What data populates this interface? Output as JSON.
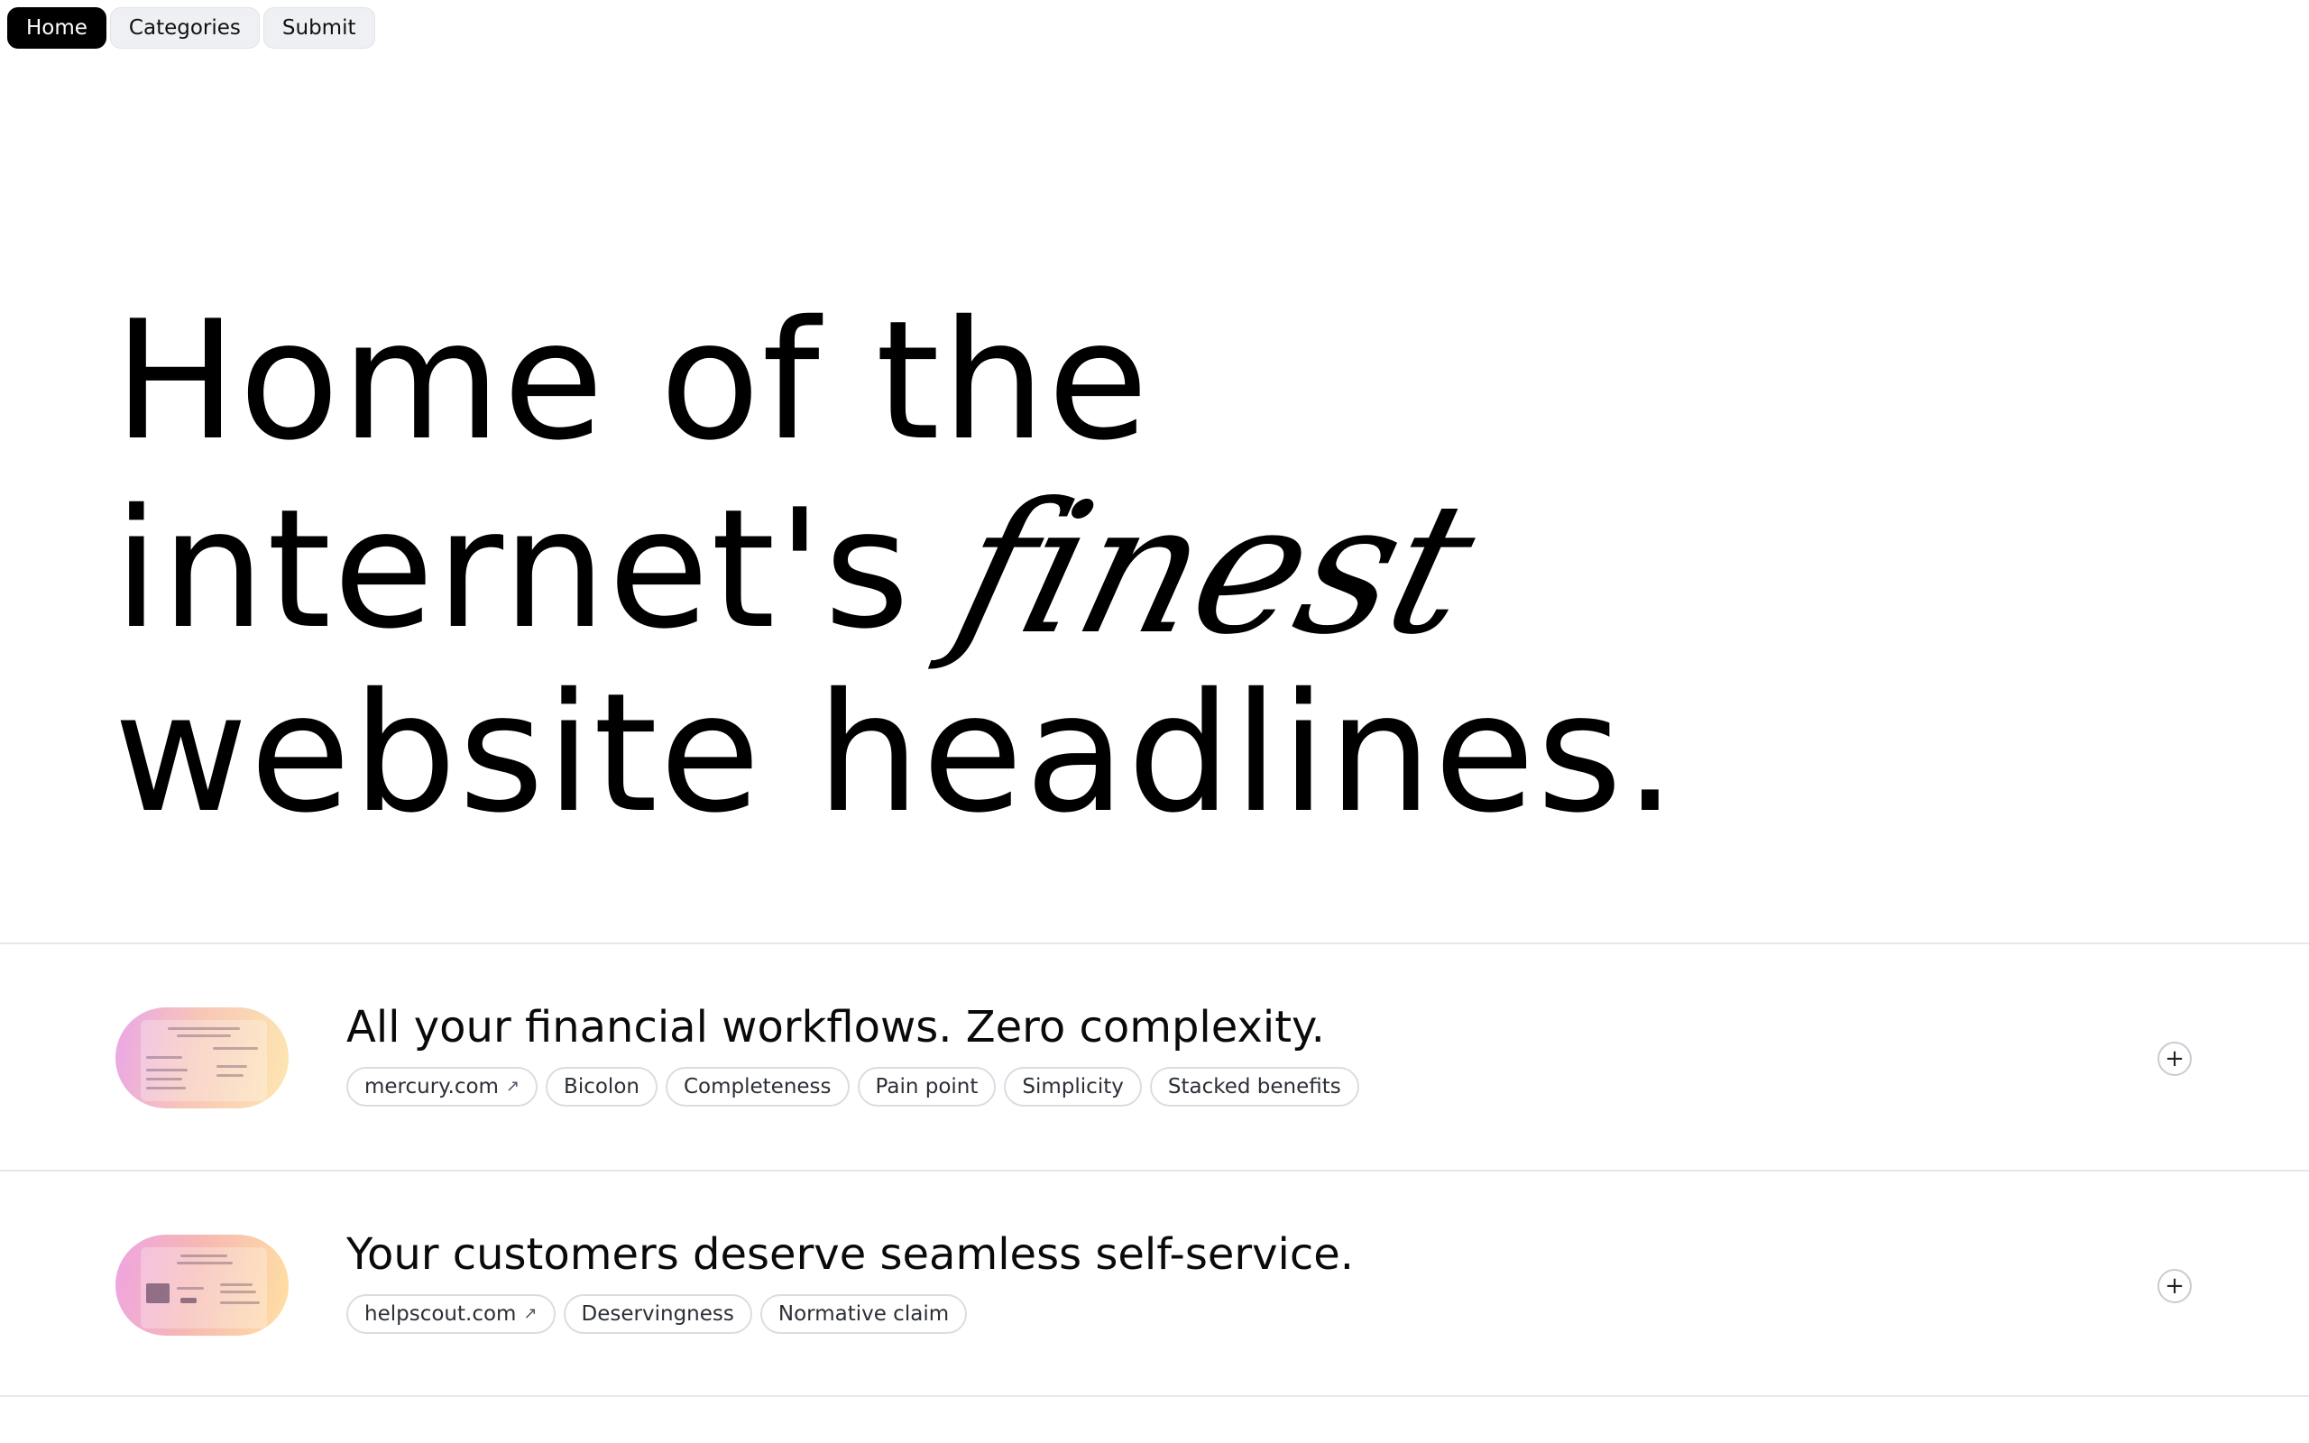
{
  "nav": {
    "items": [
      {
        "label": "Home",
        "active": true
      },
      {
        "label": "Categories",
        "active": false
      },
      {
        "label": "Submit",
        "active": false
      }
    ]
  },
  "hero": {
    "line1": "Home of the",
    "line2_prefix": "internet's",
    "line2_italic": "finest",
    "line3": "website headlines."
  },
  "entries": [
    {
      "title": "All your financial workflows. Zero complexity.",
      "domain": "mercury.com",
      "tags": [
        "Bicolon",
        "Completeness",
        "Pain point",
        "Simplicity",
        "Stacked benefits"
      ]
    },
    {
      "title": "Your customers deserve seamless self-service.",
      "domain": "helpscout.com",
      "tags": [
        "Deservingness",
        "Normative claim"
      ]
    }
  ],
  "icons": {
    "external_link": "arrow-up-right-icon",
    "add": "plus-icon"
  },
  "colors": {
    "active_nav_bg": "#000000",
    "pill_bg": "#eef0f3",
    "divider": "#e5e7eb",
    "tag_border": "#d9dde3"
  }
}
